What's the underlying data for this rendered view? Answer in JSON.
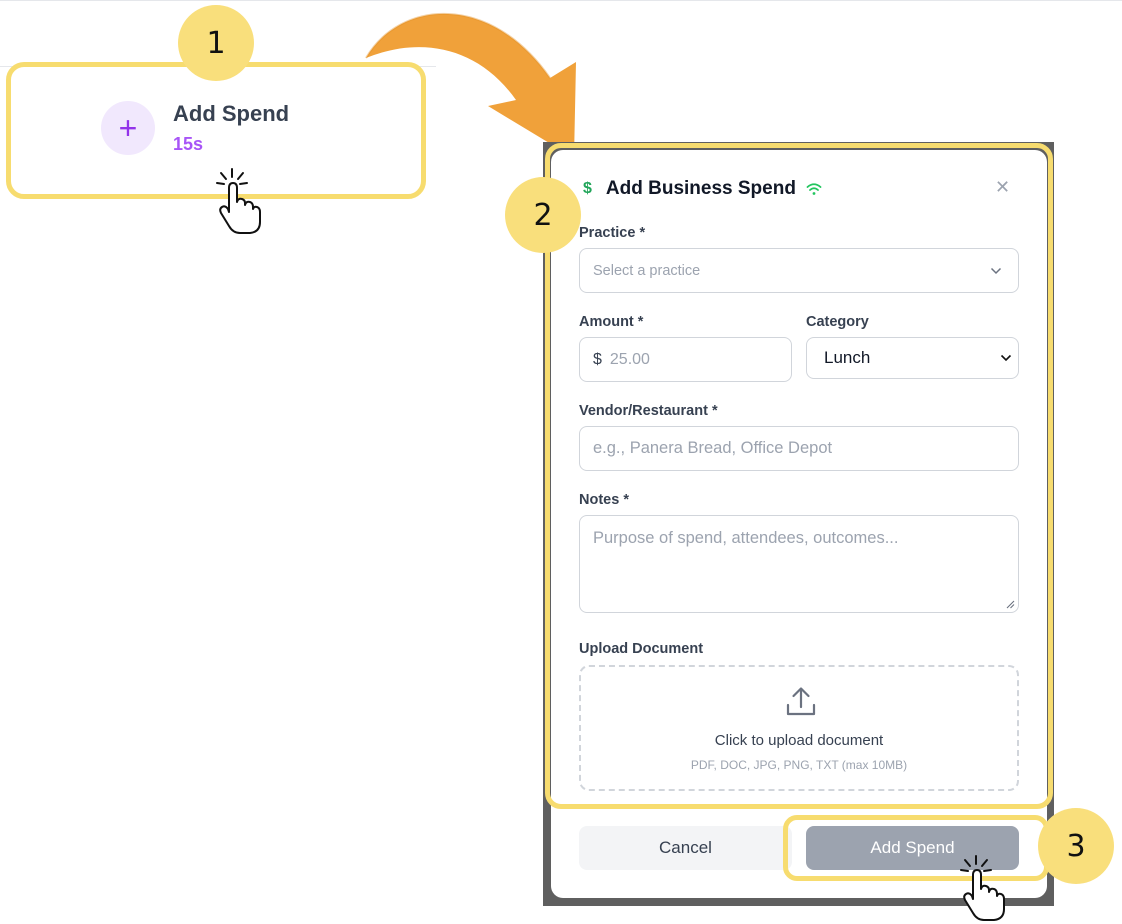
{
  "quick_action": {
    "title": "Add Spend",
    "duration": "15s"
  },
  "steps": [
    "1",
    "2",
    "3"
  ],
  "modal": {
    "title": "Add Business Spend",
    "practice": {
      "label": "Practice *",
      "placeholder": "Select a practice"
    },
    "amount": {
      "label": "Amount *",
      "currency": "$",
      "placeholder": "25.00"
    },
    "category": {
      "label": "Category",
      "value": "Lunch"
    },
    "vendor": {
      "label": "Vendor/Restaurant *",
      "placeholder": "e.g., Panera Bread, Office Depot"
    },
    "notes": {
      "label": "Notes *",
      "placeholder": "Purpose of spend, attendees, outcomes..."
    },
    "upload": {
      "label": "Upload Document",
      "main_text": "Click to upload document",
      "sub_text": "PDF, DOC, JPG, PNG, TXT (max 10MB)"
    },
    "cancel_label": "Cancel",
    "submit_label": "Add Spend"
  },
  "icons": {
    "plus": "plus-icon",
    "dollar": "dollar-icon",
    "wifi": "wifi-icon",
    "close": "close-icon",
    "chevron": "chevron-down-icon",
    "upload": "upload-icon",
    "cursor": "hand-pointer-icon",
    "arrow": "curved-arrow-icon"
  },
  "colors": {
    "highlight": "#f7dc6f",
    "badge": "#f9df7c",
    "accent_purple": "#a855f7",
    "success_green": "#22a55a",
    "arrow_orange": "#f0a13a",
    "disabled_button": "#9ca3af"
  }
}
